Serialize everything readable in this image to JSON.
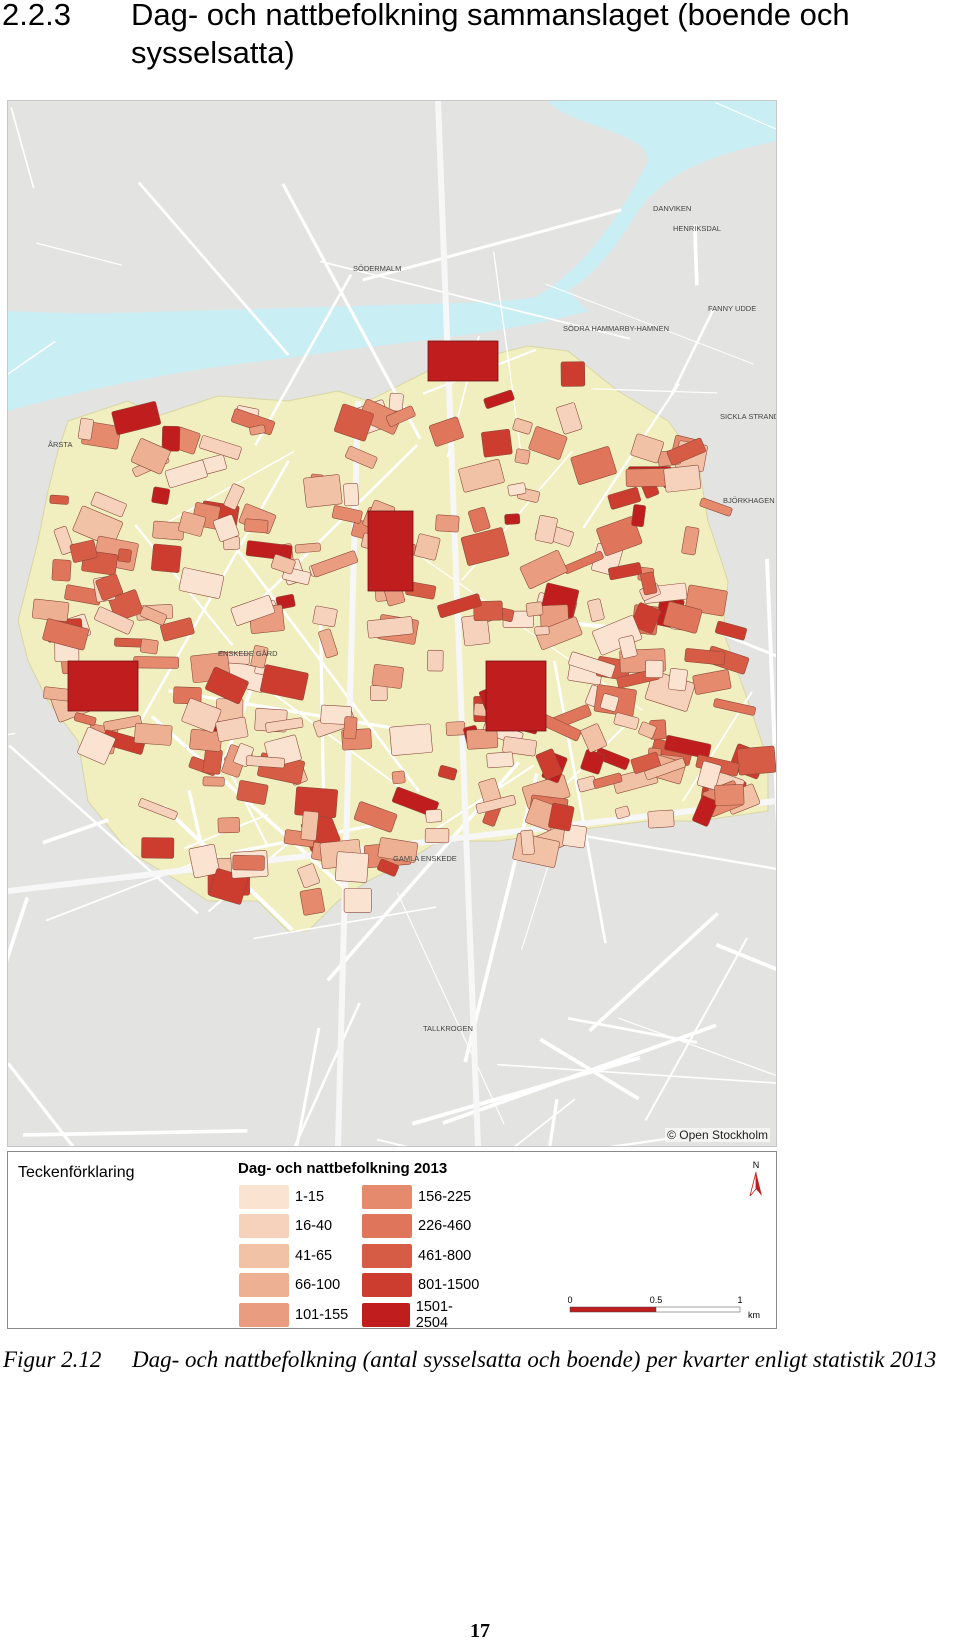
{
  "heading": {
    "number": "2.2.3",
    "title": "Dag- och nattbefolkning sammanslaget (boende och sysselsatta)"
  },
  "map": {
    "attribution": "© Open Stockholm",
    "labels": [
      "SÖDERMALM",
      "SÖDRA HAMMARBY-HAMNEN",
      "DANVIKEN",
      "HENRIKSDAL",
      "FANNY UDDE",
      "SICKLA STRAND",
      "BJÖRKHAGEN",
      "ÅRSTA",
      "ENSKEDE GÅRD",
      "GAMLA ENSKEDE",
      "TALLKROGEN"
    ],
    "colors": {
      "water": "#c9eef4",
      "land": "#e3e3e1",
      "streets": "#ffffff",
      "study_area": "#f1efbf",
      "park": "#c6c99a"
    }
  },
  "legend": {
    "heading": "Teckenförklaring",
    "title": "Dag- och nattbefolkning 2013",
    "classes": [
      {
        "label": "1-15",
        "color": "#fbe3d2"
      },
      {
        "label": "16-40",
        "color": "#f6d2bc"
      },
      {
        "label": "41-65",
        "color": "#f2c2a6"
      },
      {
        "label": "66-100",
        "color": "#eeb092"
      },
      {
        "label": "101-155",
        "color": "#e99c7f"
      },
      {
        "label": "156-225",
        "color": "#e58a6c"
      },
      {
        "label": "226-460",
        "color": "#df755a"
      },
      {
        "label": "461-800",
        "color": "#d65c45"
      },
      {
        "label": "801-1500",
        "color": "#cc3d30"
      },
      {
        "label": "1501-2504",
        "color": "#c01e1e"
      }
    ],
    "north_label": "N",
    "scale": {
      "ticks": [
        "0",
        "0.5",
        "1"
      ],
      "unit": "km"
    }
  },
  "caption": {
    "label": "Figur 2.12",
    "text": "Dag- och nattbefolkning (antal sysselsatta och boende) per kvarter enligt statistik 2013"
  },
  "page_number": "17"
}
